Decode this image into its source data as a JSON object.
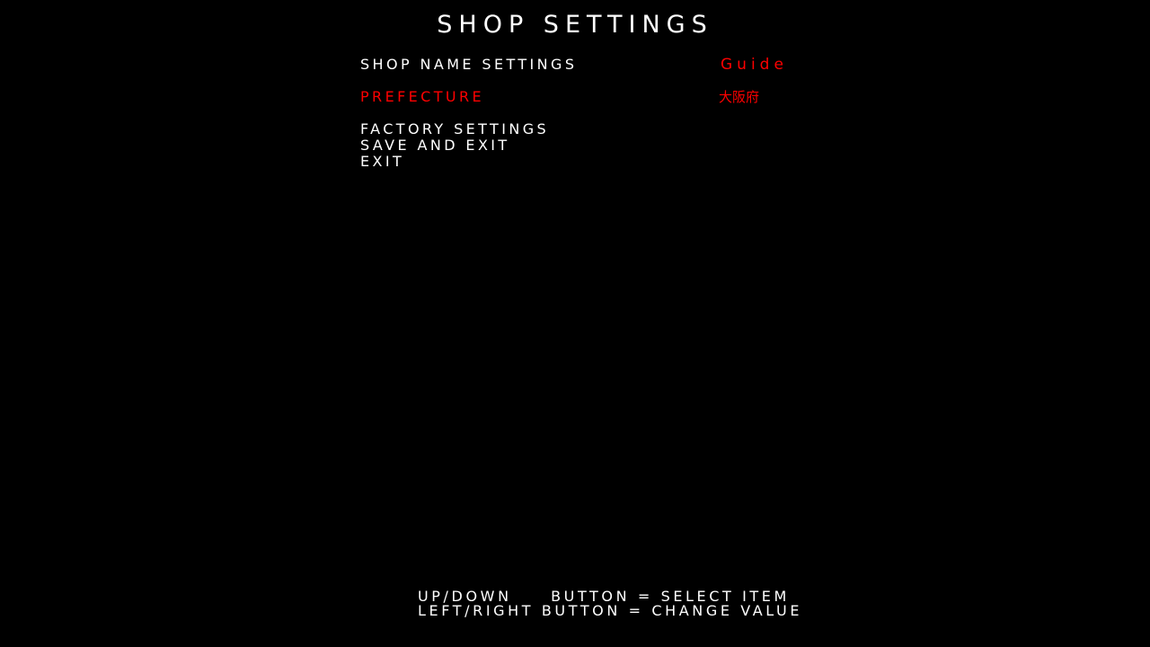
{
  "screen": {
    "title": "SHOP SETTINGS"
  },
  "menu": {
    "items": [
      {
        "label": "SHOP NAME SETTINGS",
        "value": "Guide",
        "selected": false
      },
      {
        "label": "PREFECTURE",
        "value": "大阪府",
        "selected": true
      },
      {
        "label": "FACTORY SETTINGS"
      },
      {
        "label": "SAVE AND EXIT"
      },
      {
        "label": "EXIT"
      }
    ]
  },
  "help": {
    "line1": "UP/DOWN     BUTTON = SELECT ITEM",
    "line2": "LEFT/RIGHT BUTTON = CHANGE VALUE"
  },
  "colors": {
    "background": "#000000",
    "text": "#ffffff",
    "highlight": "#ff0000"
  }
}
